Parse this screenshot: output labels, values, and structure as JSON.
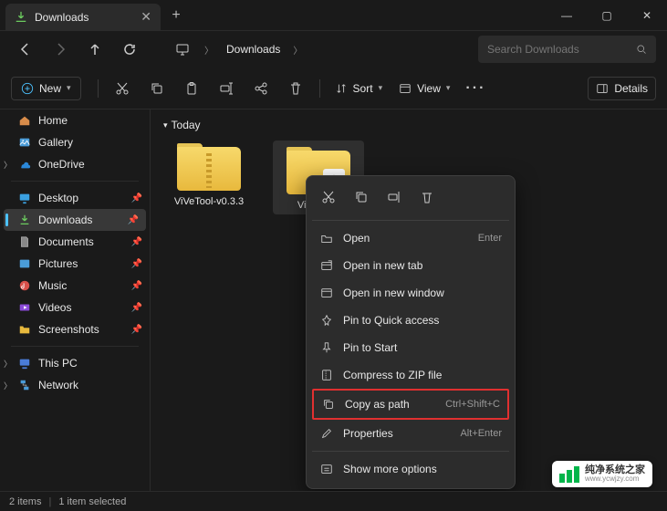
{
  "tab": {
    "title": "Downloads"
  },
  "nav": {
    "monitor": "⎚",
    "crumb": "Downloads"
  },
  "search": {
    "placeholder": "Search Downloads"
  },
  "toolbar": {
    "new_label": "New",
    "sort_label": "Sort",
    "view_label": "View",
    "details_label": "Details"
  },
  "sidebar": {
    "home": "Home",
    "gallery": "Gallery",
    "onedrive": "OneDrive",
    "desktop": "Desktop",
    "downloads": "Downloads",
    "documents": "Documents",
    "pictures": "Pictures",
    "music": "Music",
    "videos": "Videos",
    "screenshots": "Screenshots",
    "thispc": "This PC",
    "network": "Network"
  },
  "content": {
    "group": "Today",
    "files": [
      {
        "name": "ViVeTool-v0.3.3"
      },
      {
        "name": "ViVeTool-"
      }
    ]
  },
  "ctx": {
    "open": "Open",
    "open_sc": "Enter",
    "newtab": "Open in new tab",
    "newwin": "Open in new window",
    "pinqa": "Pin to Quick access",
    "pinstart": "Pin to Start",
    "zip": "Compress to ZIP file",
    "copypath": "Copy as path",
    "copypath_sc": "Ctrl+Shift+C",
    "props": "Properties",
    "props_sc": "Alt+Enter",
    "more": "Show more options"
  },
  "status": {
    "count": "2 items",
    "selected": "1 item selected"
  },
  "watermark": {
    "title": "纯净系统之家",
    "url": "www.ycwjzy.com"
  }
}
